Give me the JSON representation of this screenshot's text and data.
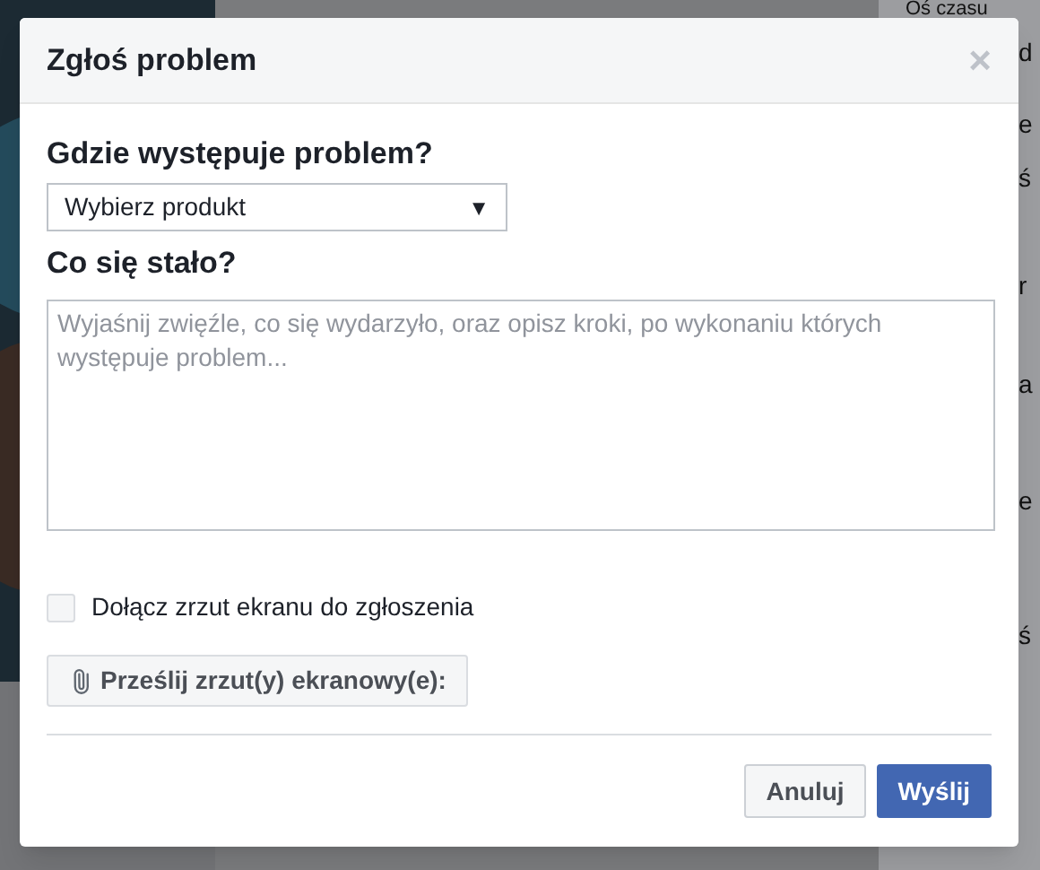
{
  "background": {
    "timeline_link": "Oś czasu",
    "fragments": [
      "d",
      "e",
      "ś",
      "r",
      "a",
      "e",
      "ś"
    ]
  },
  "dialog": {
    "title": "Zgłoś problem",
    "close": "×",
    "where_label": "Gdzie występuje problem?",
    "product_select": {
      "value": "Wybierz produkt",
      "arrow": "▼"
    },
    "what_label": "Co się stało?",
    "description": {
      "placeholder": "Wyjaśnij zwięźle, co się wydarzyło, oraz opisz kroki, po wykonaniu których występuje problem..."
    },
    "screenshot_checkbox": {
      "label": "Dołącz zrzut ekranu do zgłoszenia",
      "checked": false
    },
    "upload_button": "Prześlij zrzut(y) ekranowy(e):",
    "buttons": [
      {
        "label": "Anuluj",
        "kind": "secondary"
      },
      {
        "label": "Wyślij",
        "kind": "primary"
      }
    ]
  }
}
